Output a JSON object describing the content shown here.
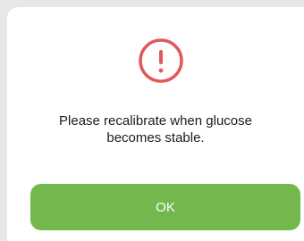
{
  "dialog": {
    "icon": "exclamation-circle-icon",
    "message_line1": "Please recalibrate when glucose",
    "message_line2": "becomes stable.",
    "ok_label": "OK"
  },
  "colors": {
    "accent": "#73b84d",
    "alert": "#e0595b"
  }
}
